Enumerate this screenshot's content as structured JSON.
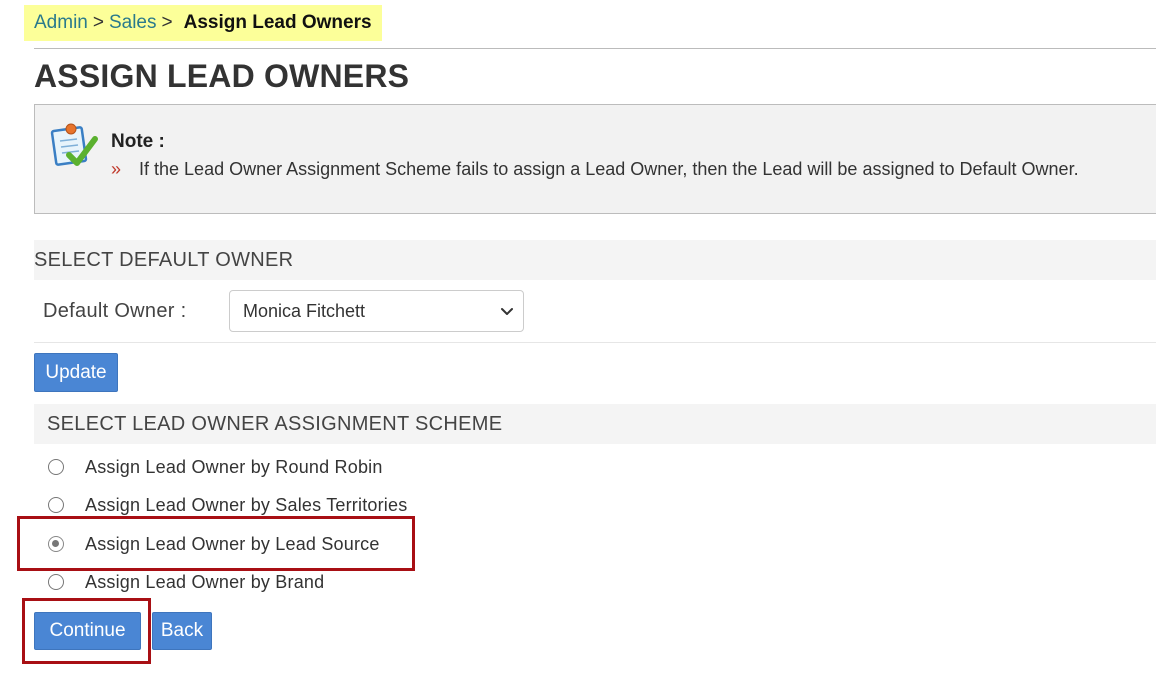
{
  "breadcrumb": {
    "admin": "Admin",
    "sales": "Sales",
    "current": "Assign Lead Owners",
    "separator": ">"
  },
  "page": {
    "title": "ASSIGN LEAD OWNERS"
  },
  "note": {
    "title": "Note :",
    "bullet": "»",
    "text": "If the Lead Owner Assignment Scheme fails to assign a Lead Owner, then the Lead will be assigned to Default Owner."
  },
  "default_owner_section": {
    "header": "SELECT DEFAULT OWNER",
    "label": "Default Owner :",
    "selected_value": "Monica Fitchett",
    "update_label": "Update"
  },
  "scheme_section": {
    "header": "SELECT LEAD OWNER ASSIGNMENT SCHEME",
    "options": [
      {
        "label": "Assign Lead Owner by Round Robin",
        "checked": false
      },
      {
        "label": "Assign Lead Owner by Sales Territories",
        "checked": false
      },
      {
        "label": "Assign Lead Owner by Lead Source",
        "checked": true
      },
      {
        "label": "Assign Lead Owner by Brand",
        "checked": false
      }
    ]
  },
  "actions": {
    "continue_label": "Continue",
    "back_label": "Back"
  },
  "colors": {
    "button_bg": "#4a86d4",
    "breadcrumb_highlight": "#fcff99",
    "annotation_red": "#a80f14",
    "link": "#2a7a8c"
  },
  "icons": {
    "note": "note-pad-check-icon",
    "select": "chevron-down-icon"
  }
}
